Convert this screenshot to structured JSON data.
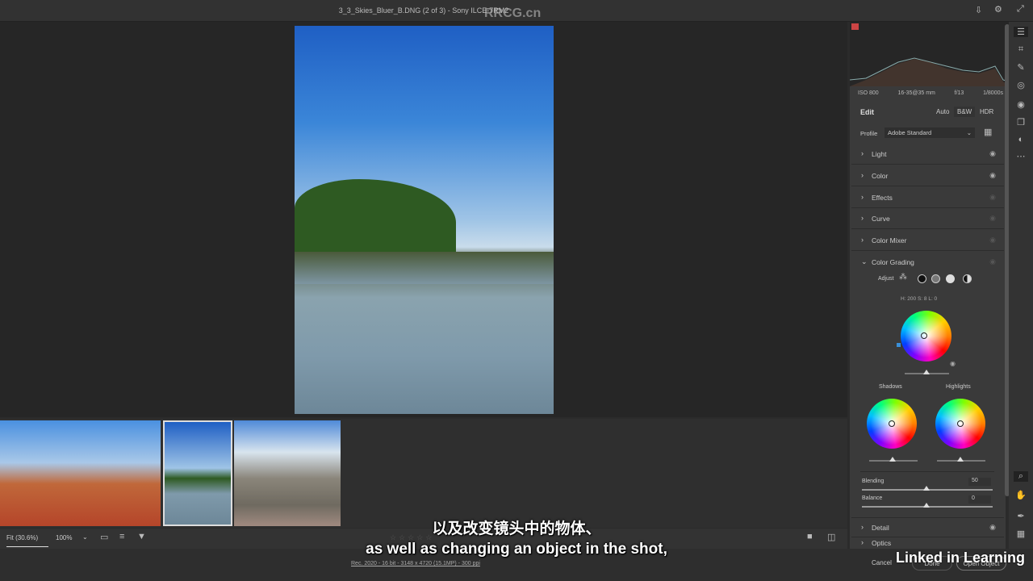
{
  "window": {
    "title": "3_3_Skies_Bluer_B.DNG (2 of 3)  -  Sony ILCE-7RM2"
  },
  "top_icons": [
    "save-icon",
    "gear-icon",
    "expand-icon"
  ],
  "histogram": {
    "iso": "ISO 800",
    "lens": "16-35@35 mm",
    "aperture": "f/13",
    "shutter": "1/8000s"
  },
  "edit": {
    "title": "Edit",
    "auto": "Auto",
    "bw": "B&W",
    "hdr": "HDR",
    "profile_label": "Profile",
    "profile_value": "Adobe Standard"
  },
  "sections": [
    {
      "label": "Light",
      "visible": true
    },
    {
      "label": "Color",
      "visible": true
    },
    {
      "label": "Effects",
      "visible": false
    },
    {
      "label": "Curve",
      "visible": false
    },
    {
      "label": "Color Mixer",
      "visible": false
    }
  ],
  "color_grading": {
    "label": "Color Grading",
    "adjust": "Adjust",
    "readout": "H: 200  S: 8   L: 0",
    "shadows": "Shadows",
    "highlights": "Highlights",
    "blending_label": "Blending",
    "blending_value": "50",
    "balance_label": "Balance",
    "balance_value": "0"
  },
  "detail": {
    "label": "Detail"
  },
  "optics": {
    "label": "Optics"
  },
  "bottom": {
    "fit": "Fit (30.6%)",
    "zoom": "100%",
    "info": "Rec. 2020 - 16 bit - 3148 x 4720 (15.1MP) - 300 ppi"
  },
  "actions": {
    "cancel": "Cancel",
    "done": "Done",
    "open": "Open Object"
  },
  "subtitles": {
    "zh": "以及改变镜头中的物体、",
    "en": "as well as changing an object in the shot,"
  },
  "branding": {
    "linkedin": "Linked in Learning",
    "watermark": "RRCG.cn"
  }
}
